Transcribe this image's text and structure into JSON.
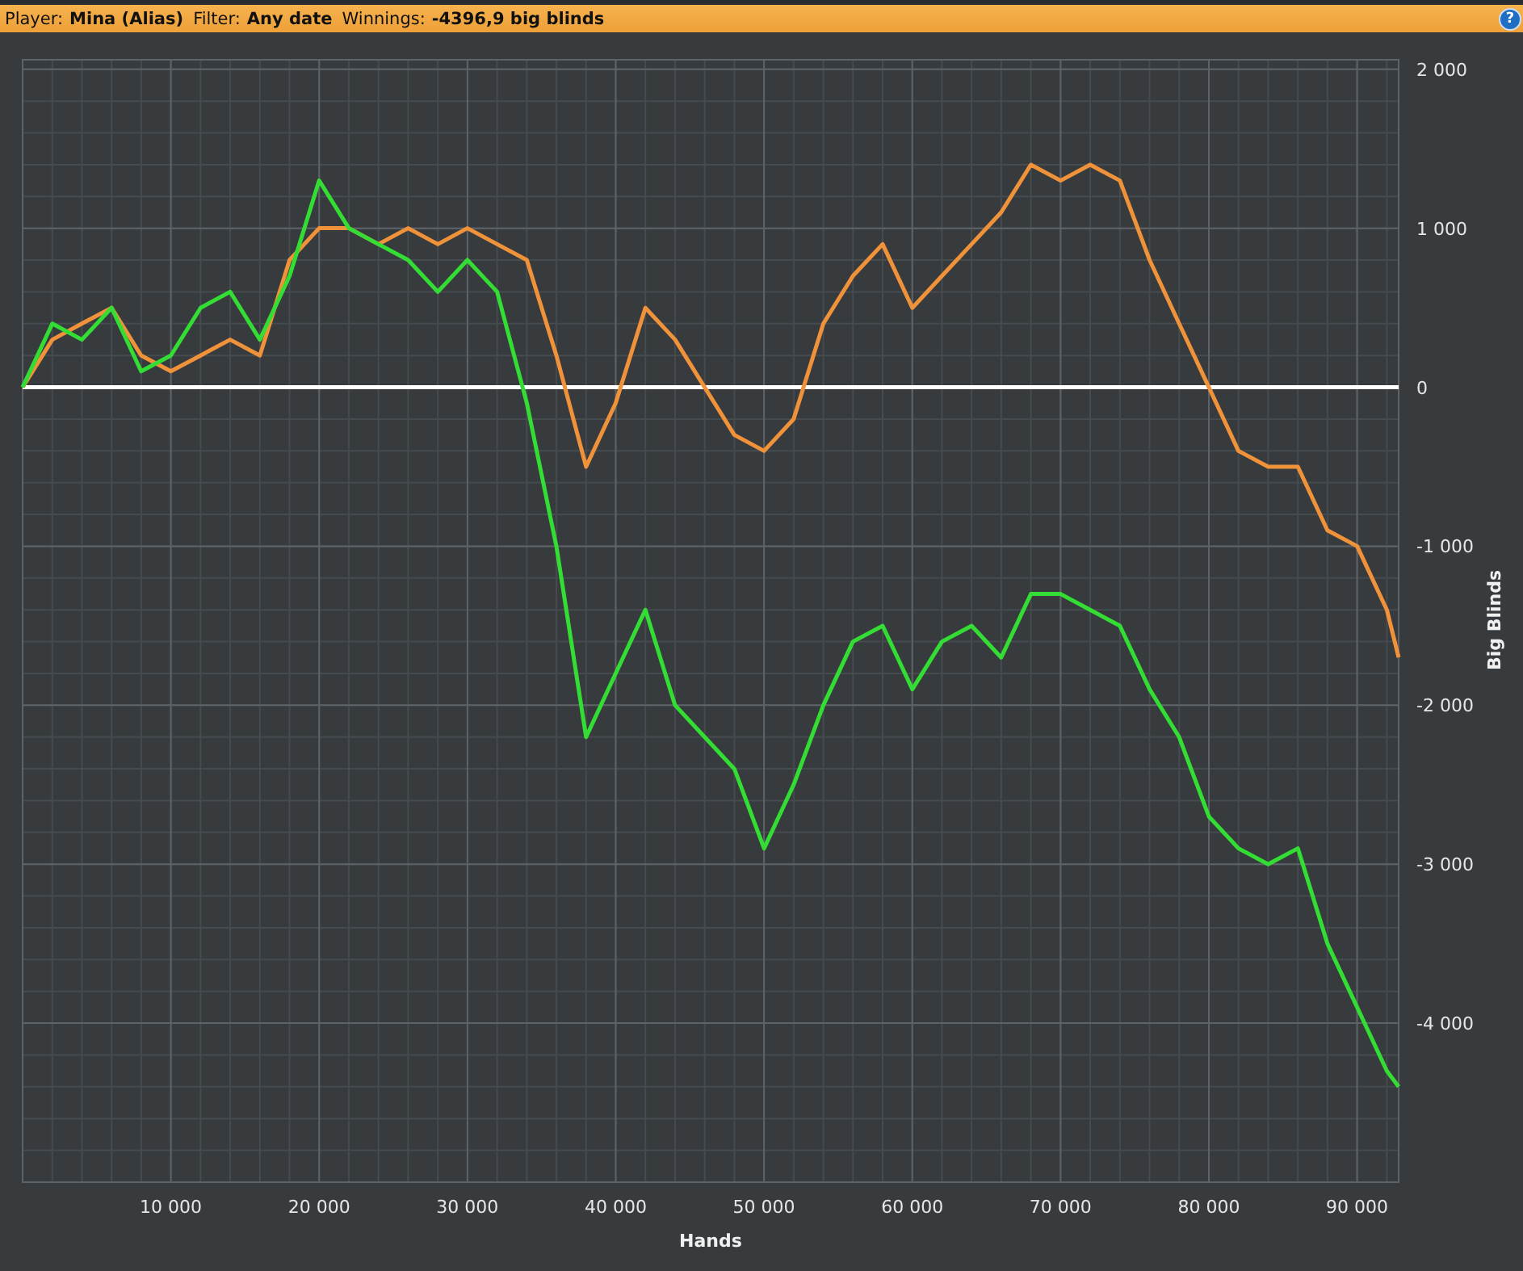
{
  "header": {
    "fields": [
      {
        "label": "Player:",
        "value": "Mina (Alias)"
      },
      {
        "label": "Filter:",
        "value": "Any date"
      },
      {
        "label": "Winnings:",
        "value": "-4396,9 big blinds"
      }
    ],
    "help": "?"
  },
  "chart": {
    "chart_data": {
      "type": "line",
      "xlabel": "Hands",
      "ylabel": "Big Blinds",
      "x": [
        0,
        2000,
        4000,
        6000,
        8000,
        10000,
        12000,
        14000,
        16000,
        18000,
        20000,
        22000,
        24000,
        26000,
        28000,
        30000,
        32000,
        34000,
        36000,
        38000,
        40000,
        42000,
        44000,
        46000,
        48000,
        50000,
        52000,
        54000,
        56000,
        58000,
        60000,
        62000,
        64000,
        66000,
        68000,
        70000,
        72000,
        74000,
        76000,
        78000,
        80000,
        82000,
        84000,
        86000,
        88000,
        90000,
        92000,
        92800
      ],
      "series": [
        {
          "color": "#f0923a",
          "values": [
            0,
            300,
            400,
            500,
            200,
            100,
            200,
            300,
            200,
            800,
            1000,
            1000,
            900,
            1000,
            900,
            1000,
            900,
            800,
            200,
            -500,
            -100,
            500,
            300,
            0,
            -300,
            -400,
            -200,
            400,
            700,
            900,
            500,
            700,
            900,
            1100,
            1400,
            1300,
            1400,
            1300,
            800,
            400,
            0,
            -400,
            -500,
            -500,
            -900,
            -1000,
            -1400,
            -1700
          ]
        },
        {
          "color": "#33dd33",
          "values": [
            0,
            400,
            300,
            500,
            100,
            200,
            500,
            600,
            300,
            700,
            1300,
            1000,
            900,
            800,
            600,
            800,
            600,
            -100,
            -1000,
            -2200,
            -1800,
            -1400,
            -2000,
            -2200,
            -2400,
            -2900,
            -2500,
            -2000,
            -1600,
            -1500,
            -1900,
            -1600,
            -1500,
            -1700,
            -1300,
            -1300,
            -1400,
            -1500,
            -1900,
            -2200,
            -2700,
            -2900,
            -3000,
            -2900,
            -3500,
            -3900,
            -4300,
            -4400
          ]
        }
      ],
      "grid": true,
      "xlim": [
        0,
        92800
      ],
      "ylim": [
        -5000,
        2060
      ],
      "xticks": [
        {
          "value": 10000,
          "label": "10 000"
        },
        {
          "value": 20000,
          "label": "20 000"
        },
        {
          "value": 30000,
          "label": "30 000"
        },
        {
          "value": 40000,
          "label": "40 000"
        },
        {
          "value": 50000,
          "label": "50 000"
        },
        {
          "value": 60000,
          "label": "60 000"
        },
        {
          "value": 70000,
          "label": "70 000"
        },
        {
          "value": 80000,
          "label": "80 000"
        },
        {
          "value": 90000,
          "label": "90 000"
        }
      ],
      "yticks": [
        {
          "value": 2000,
          "label": "2 000"
        },
        {
          "value": 1000,
          "label": "1 000"
        },
        {
          "value": 0,
          "label": "0"
        },
        {
          "value": -1000,
          "label": "-1 000"
        },
        {
          "value": -2000,
          "label": "-2 000"
        },
        {
          "value": -3000,
          "label": "-3 000"
        },
        {
          "value": -4000,
          "label": "-4 000"
        }
      ]
    }
  }
}
